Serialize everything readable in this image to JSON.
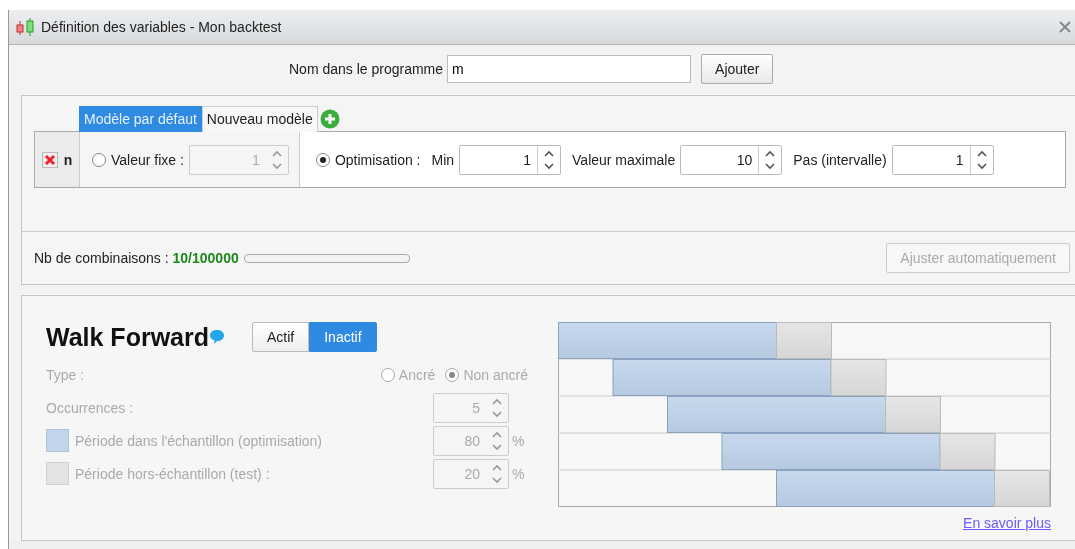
{
  "window": {
    "title": "Définition des variables - Mon backtest"
  },
  "name_field": {
    "label": "Nom dans le programme",
    "value": "m"
  },
  "add_button": "Ajouter",
  "tabs": [
    {
      "label": "Modèle par défaut",
      "selected": true
    },
    {
      "label": "Nouveau modèle",
      "selected": false
    }
  ],
  "variable": {
    "name": "n",
    "fixed": {
      "label": "Valeur fixe :",
      "value": "1",
      "selected": false
    },
    "optimisation": {
      "label": "Optimisation :",
      "selected": true
    },
    "fields": [
      {
        "label": "Min",
        "value": "1"
      },
      {
        "label": "Valeur maximale",
        "value": "10"
      },
      {
        "label": "Pas (intervalle)",
        "value": "1"
      }
    ]
  },
  "combinations": {
    "label": "Nb de combinaisons :",
    "value": "10/100000",
    "level": 0.0001
  },
  "auto_button": {
    "label": "Ajuster automatiquement",
    "disabled": true
  },
  "walk_forward": {
    "title": "Walk Forward",
    "disabled": true,
    "toggle": [
      {
        "label": "Actif",
        "selected": false
      },
      {
        "label": "Inactif",
        "selected": true
      }
    ],
    "type": {
      "label": "Type :",
      "options": [
        {
          "label": "Ancré",
          "selected": false
        },
        {
          "label": "Non ancré",
          "selected": true
        }
      ]
    },
    "rows": [
      {
        "kind": "plain",
        "label": "Occurrences :",
        "value": "5"
      },
      {
        "kind": "in_sample",
        "label": "Période dans l'échantillon (optimisation)",
        "value": "80",
        "unit": "%"
      },
      {
        "kind": "out_sample",
        "label": "Période hors-échantillon (test) :",
        "value": "20",
        "unit": "%"
      }
    ],
    "link": "En savoir plus"
  }
}
